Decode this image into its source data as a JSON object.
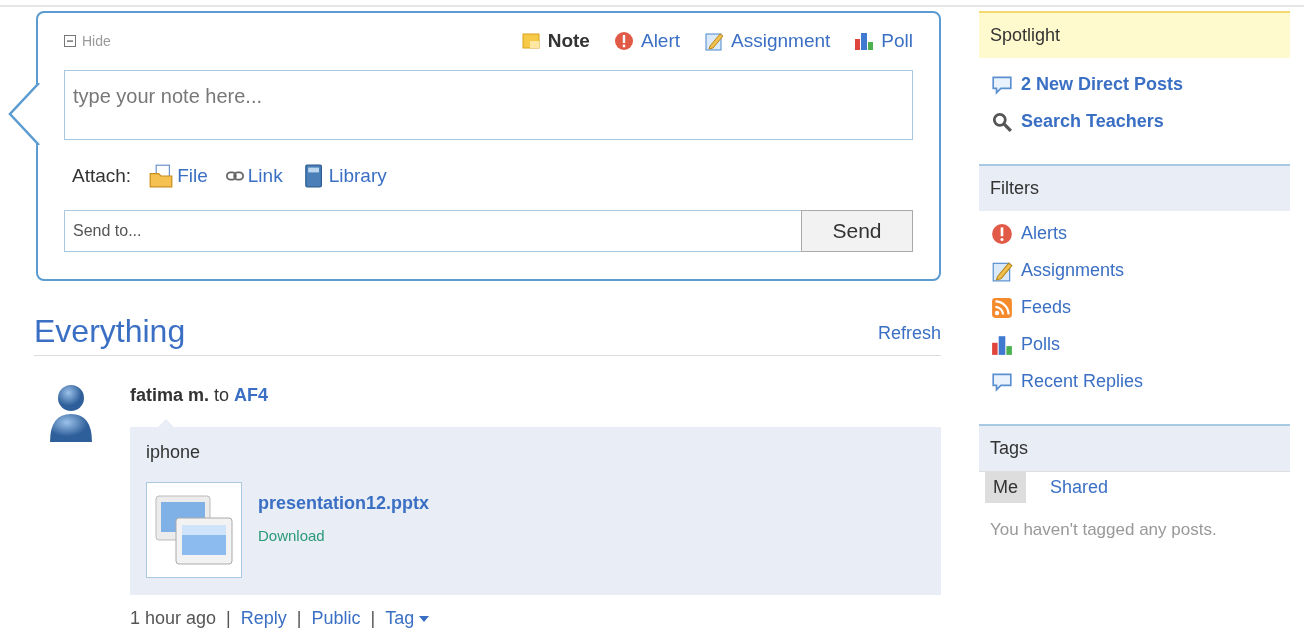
{
  "composer": {
    "hide_label": "Hide",
    "post_types": [
      {
        "kind": "note",
        "label": "Note",
        "selected": true
      },
      {
        "kind": "alert",
        "label": "Alert",
        "selected": false
      },
      {
        "kind": "assignment",
        "label": "Assignment",
        "selected": false
      },
      {
        "kind": "poll",
        "label": "Poll",
        "selected": false
      }
    ],
    "note": {
      "placeholder": "type your note here..."
    },
    "attach_label": "Attach:",
    "attachments": [
      {
        "kind": "file",
        "label": "File"
      },
      {
        "kind": "link",
        "label": "Link"
      },
      {
        "kind": "library",
        "label": "Library"
      }
    ],
    "send_to": {
      "placeholder": "Send to..."
    },
    "send_button": "Send"
  },
  "feed": {
    "title": "Everything",
    "refresh": "Refresh",
    "posts": [
      {
        "author": "fatima m.",
        "to_word": "to",
        "recipient": "AF4",
        "text": "iphone",
        "attachment": {
          "name": "presentation12.pptx",
          "action": "Download"
        },
        "time": "1 hour ago",
        "separator": "|",
        "actions": [
          "Reply",
          "Public",
          "Tag"
        ]
      }
    ]
  },
  "sidebar": {
    "spotlight": {
      "title": "Spotlight",
      "items": [
        {
          "kind": "bubble",
          "label": "2 New Direct Posts"
        },
        {
          "kind": "search",
          "label": "Search Teachers"
        }
      ]
    },
    "filters": {
      "title": "Filters",
      "items": [
        {
          "kind": "alert",
          "label": "Alerts"
        },
        {
          "kind": "assignment",
          "label": "Assignments"
        },
        {
          "kind": "feed",
          "label": "Feeds"
        },
        {
          "kind": "poll",
          "label": "Polls"
        },
        {
          "kind": "bubble",
          "label": "Recent Replies"
        }
      ]
    },
    "tags": {
      "title": "Tags",
      "tabs": [
        {
          "label": "Me",
          "selected": true
        },
        {
          "label": "Shared",
          "selected": false
        }
      ],
      "empty_text": "You haven't tagged any posts."
    }
  }
}
